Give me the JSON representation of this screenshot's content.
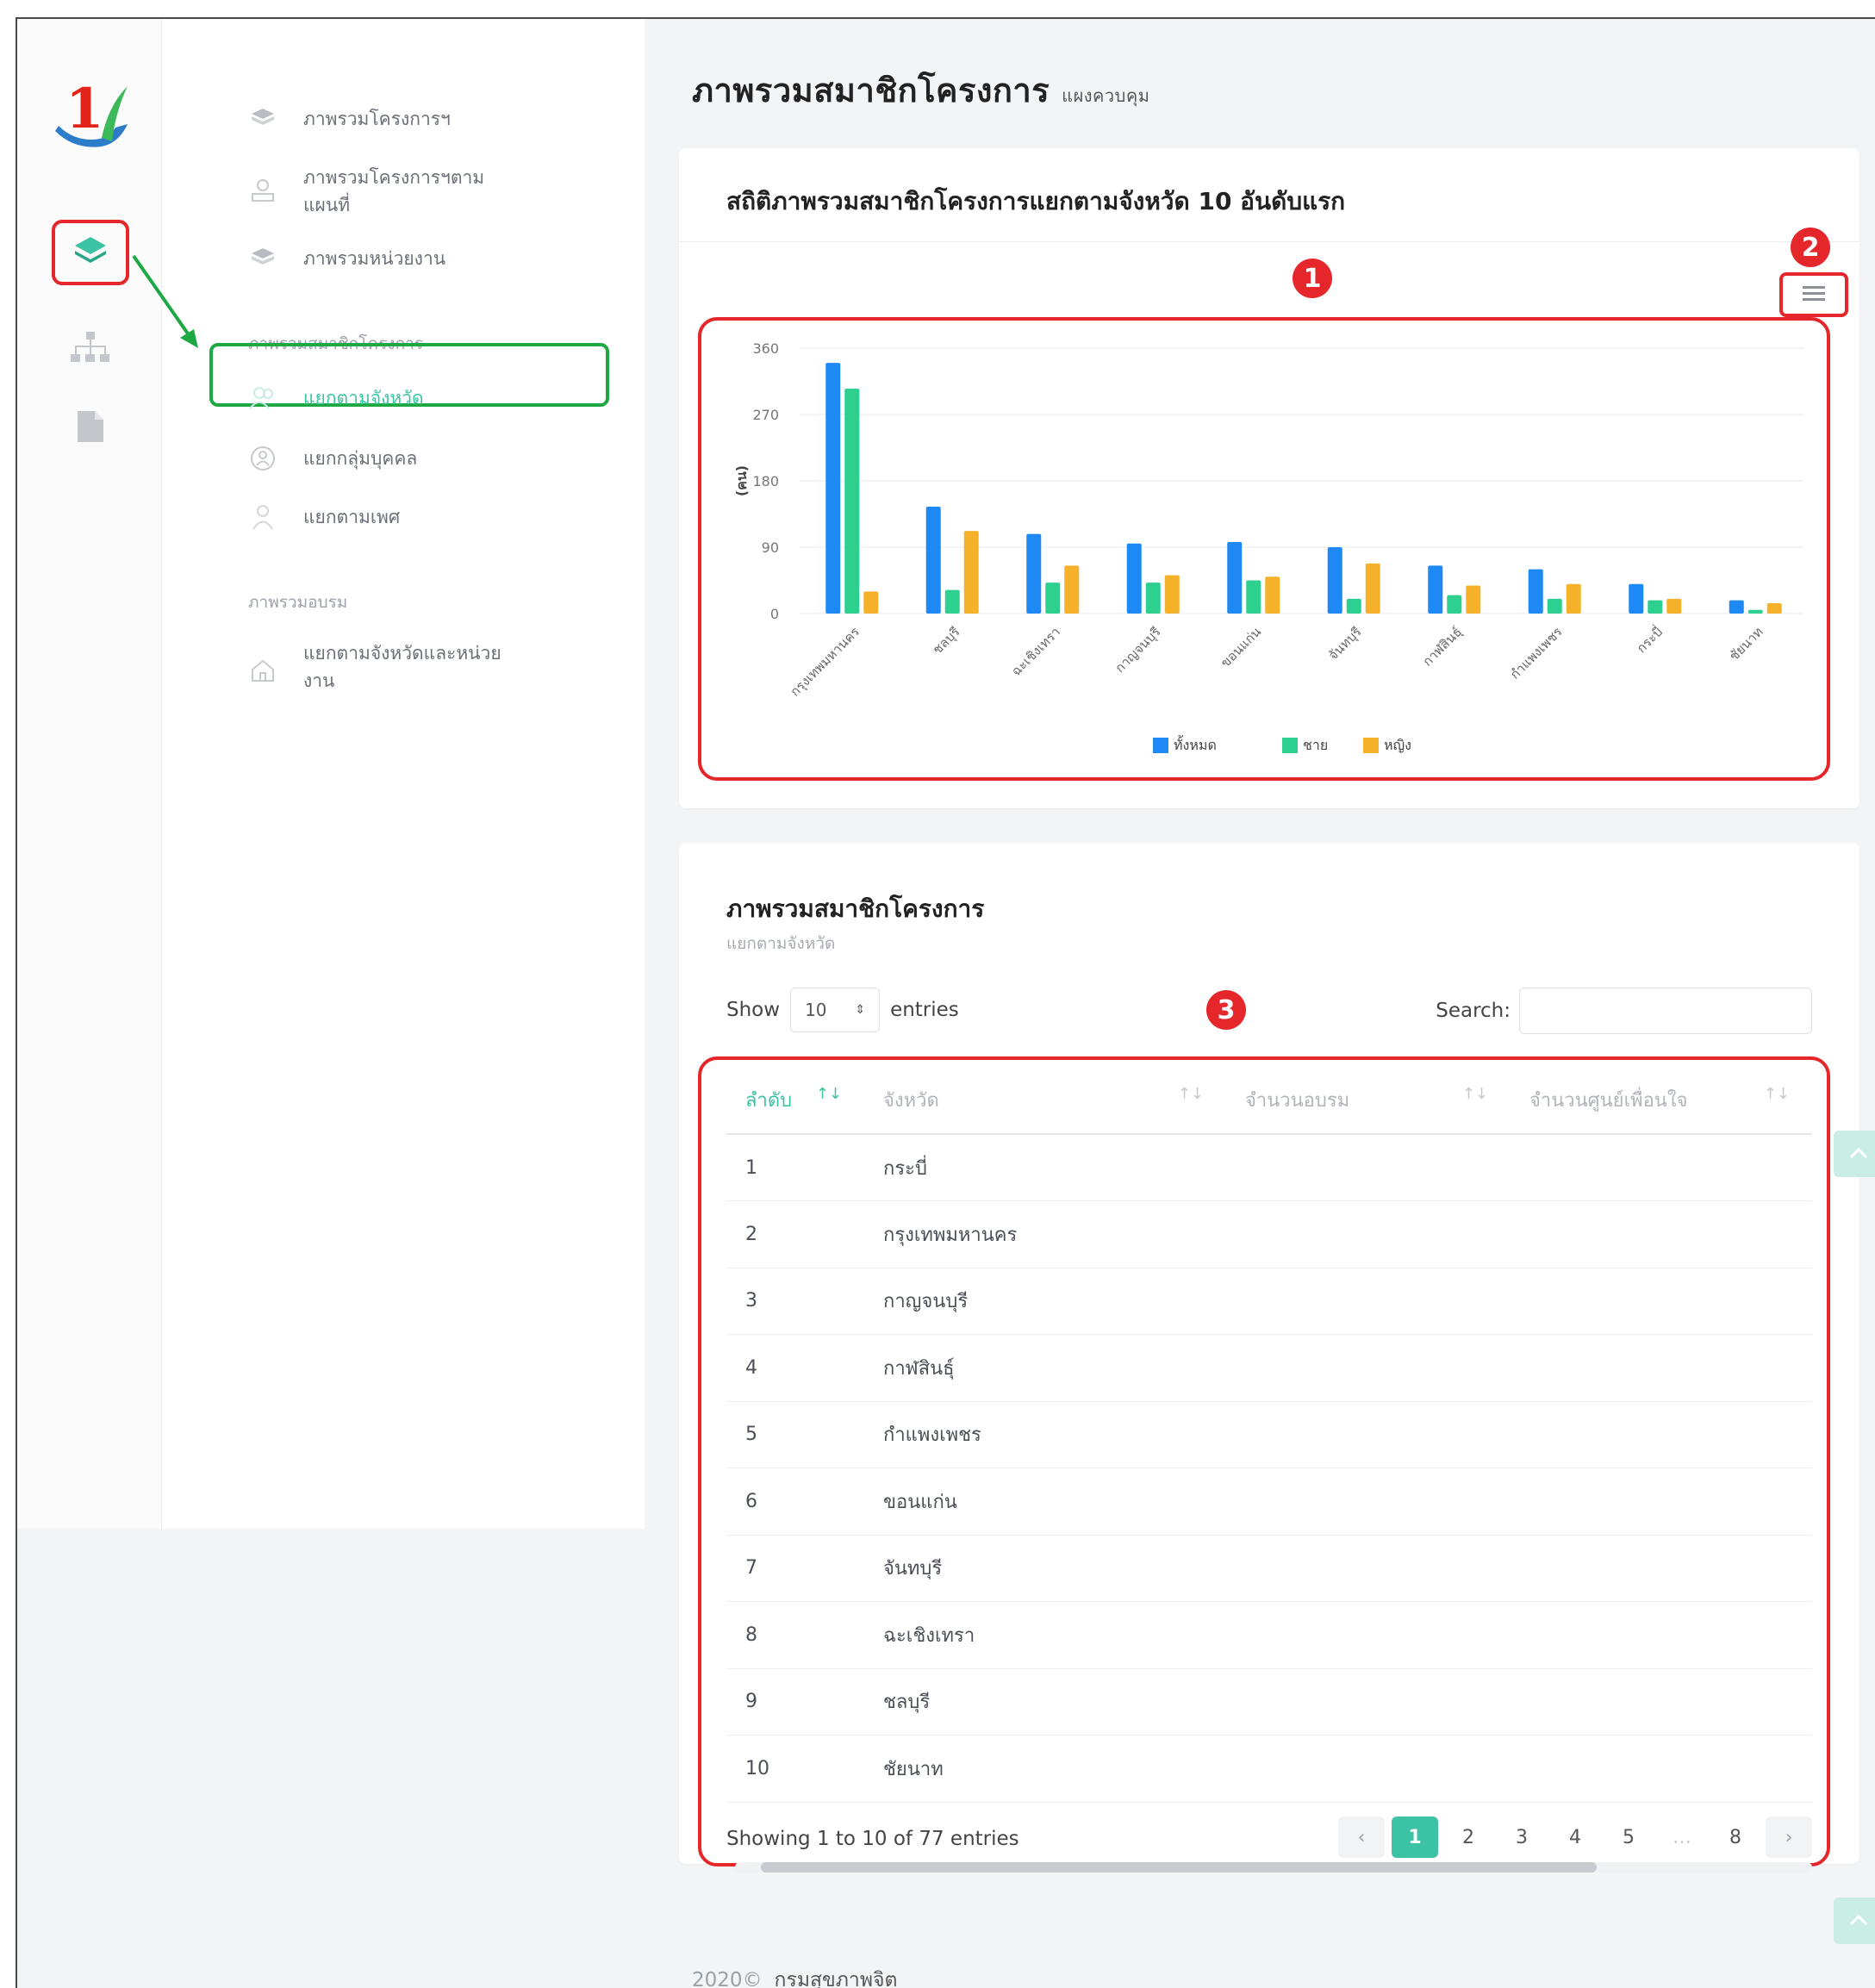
{
  "colors": {
    "accent": "#3cc3a4",
    "highlight": "#e5262b",
    "menu_highlight": "#1ea843",
    "bar_total": "#1e88f5",
    "bar_male": "#2ed08f",
    "bar_female": "#f6b12b"
  },
  "rail": {
    "items": [
      {
        "icon": "layers-icon",
        "selected": true
      },
      {
        "icon": "sitemap-icon",
        "selected": false
      },
      {
        "icon": "document-icon",
        "selected": false
      }
    ]
  },
  "menu": {
    "items_top": [
      {
        "label": "ภาพรวมโครงการฯ",
        "icon": "cube-icon"
      },
      {
        "label": "ภาพรวมโครงการฯตามแผนที่",
        "icon": "map-icon"
      },
      {
        "label": "ภาพรวมหน่วยงาน",
        "icon": "cube-icon"
      }
    ],
    "section_members": "ภาพรวมสมาชิกโครงการ",
    "items_members": [
      {
        "label": "แยกตามจังหวัด",
        "icon": "users-icon",
        "active": true
      },
      {
        "label": "แยกกลุ่มบุคคล",
        "icon": "group-icon",
        "active": false
      },
      {
        "label": "แยกตามเพศ",
        "icon": "person-icon",
        "active": false
      }
    ],
    "section_training": "ภาพรวมอบรม",
    "items_training": [
      {
        "label": "แยกตามจังหวัดและหน่วยงาน",
        "icon": "home-icon"
      }
    ]
  },
  "page": {
    "title": "ภาพรวมสมาชิกโครงการ",
    "subtitle": "แผงควบคุม"
  },
  "chart_card": {
    "title": "สถิติภาพรวมสมาชิกโครงการแยกตามจังหวัด 10 อันดับแรก",
    "menu_icon": "hamburger-icon"
  },
  "annotations": {
    "one": "1",
    "two": "2",
    "three": "3"
  },
  "chart_data": {
    "type": "bar",
    "title": "",
    "xlabel": "",
    "ylabel": "(คน)",
    "ylim": [
      0,
      360
    ],
    "yticks": [
      0,
      90,
      180,
      270,
      360
    ],
    "grid": true,
    "legend_position": "bottom",
    "categories": [
      "กรุงเทพมหานคร",
      "ชลบุรี",
      "ฉะเชิงเทรา",
      "กาญจนบุรี",
      "ขอนแก่น",
      "จันทบุรี",
      "กาฬสินธุ์",
      "กำแพงเพชร",
      "กระบี่",
      "ชัยนาท"
    ],
    "series": [
      {
        "name": "ทั้งหมด",
        "values": [
          340,
          145,
          108,
          95,
          97,
          90,
          65,
          60,
          40,
          18
        ]
      },
      {
        "name": "ชาย",
        "values": [
          305,
          32,
          42,
          42,
          45,
          20,
          25,
          20,
          18,
          5
        ]
      },
      {
        "name": "หญิง",
        "values": [
          30,
          112,
          65,
          52,
          50,
          68,
          38,
          40,
          20,
          14
        ]
      }
    ]
  },
  "table_card": {
    "title": "ภาพรวมสมาชิกโครงการ",
    "subtitle": "แยกตามจังหวัด",
    "show_label": "Show",
    "page_size": "10",
    "entries_label": "entries",
    "search_label": "Search:",
    "search_value": "",
    "columns": [
      "ลำดับ",
      "จังหวัด",
      "จำนวนอบรม",
      "จำนวนศูนย์เพื่อนใจ"
    ],
    "rows": [
      [
        "1",
        "กระบี่"
      ],
      [
        "2",
        "กรุงเทพมหานคร"
      ],
      [
        "3",
        "กาญจนบุรี"
      ],
      [
        "4",
        "กาฬสินธุ์"
      ],
      [
        "5",
        "กำแพงเพชร"
      ],
      [
        "6",
        "ขอนแก่น"
      ],
      [
        "7",
        "จันทบุรี"
      ],
      [
        "8",
        "ฉะเชิงเทรา"
      ],
      [
        "9",
        "ชลบุรี"
      ],
      [
        "10",
        "ชัยนาท"
      ]
    ],
    "info": "Showing 1 to 10 of 77 entries",
    "pages": [
      "1",
      "2",
      "3",
      "4",
      "5",
      "…",
      "8"
    ],
    "current_page": "1",
    "prev_symbol": "‹",
    "next_symbol": "›"
  },
  "footer": {
    "year": "2020©",
    "org": "กรมสุขภาพจิต"
  }
}
